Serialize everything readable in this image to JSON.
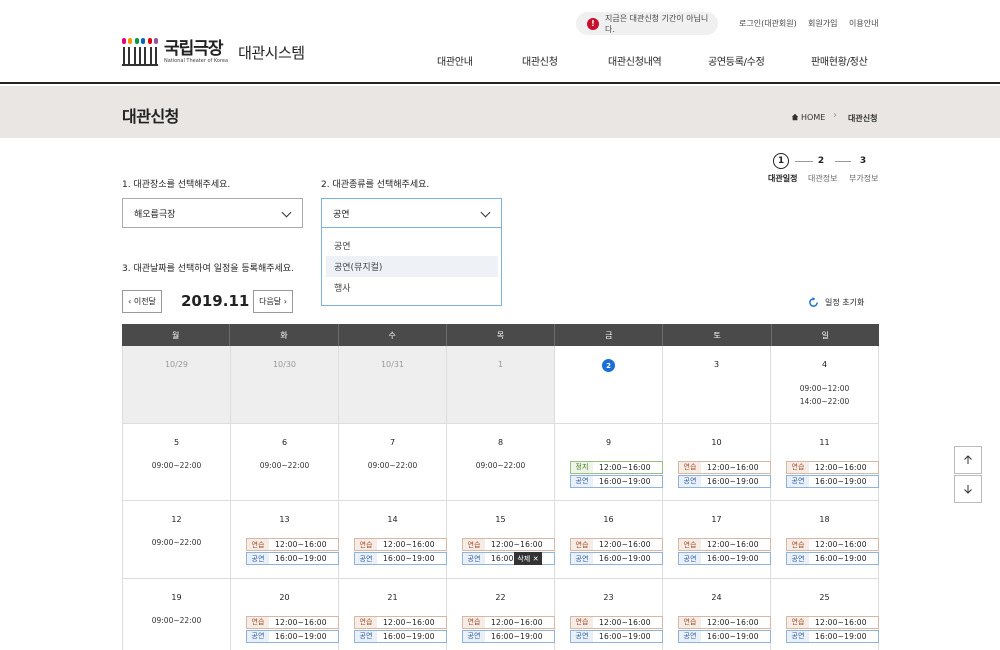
{
  "header": {
    "logo_name": "국립극장",
    "logo_sub": "National Theater of Korea",
    "system_name": "대관시스템",
    "notice": "지금은 대관신청 기간이 아닙니다.",
    "util": [
      "로그인(대관회원)",
      "회원가입",
      "이용안내"
    ],
    "gnb": [
      "대관안내",
      "대관신청",
      "대관신청내역",
      "공연등록/수정",
      "판매현황/정산"
    ]
  },
  "page": {
    "title": "대관신청",
    "breadcrumb_home": "HOME",
    "breadcrumb_current": "대관신청"
  },
  "steps": [
    {
      "num": "1",
      "label": "대관일정"
    },
    {
      "num": "2",
      "label": "대관정보"
    },
    {
      "num": "3",
      "label": "부가정보"
    }
  ],
  "form": {
    "q1": "1. 대관장소를 선택해주세요.",
    "q1_value": "해오름극장",
    "q2": "2. 대관종류를 선택해주세요.",
    "q2_value": "공연",
    "q2_options": [
      "공연",
      "공연(뮤지컬)",
      "행사"
    ],
    "q3": "3. 대관날짜를 선택하여 일정을 등록해주세요."
  },
  "calendar": {
    "prev_label": "이전달",
    "next_label": "다음달",
    "month": "2019.11",
    "reset_label": "일정 초기화",
    "weekdays": [
      "월",
      "화",
      "수",
      "목",
      "금",
      "토",
      "일"
    ],
    "tags": {
      "rehearsal": "연습",
      "show": "공연",
      "stop": "정지"
    },
    "delete_label": "삭제",
    "rows": [
      [
        {
          "date": "10/29"
        },
        {
          "date": "10/30"
        },
        {
          "date": "10/31"
        },
        {
          "date": "1"
        },
        {
          "date": "2"
        },
        {
          "date": "3"
        },
        {
          "date": "4",
          "times": [
            "09:00~12:00",
            "14:00~22:00"
          ]
        }
      ],
      [
        {
          "date": "5",
          "times": [
            "09:00~22:00"
          ]
        },
        {
          "date": "6",
          "times": [
            "09:00~22:00"
          ]
        },
        {
          "date": "7",
          "times": [
            "09:00~22:00"
          ]
        },
        {
          "date": "8",
          "times": [
            "09:00~22:00"
          ]
        },
        {
          "date": "9",
          "slot1": "12:00~16:00",
          "slot2": "16:00~19:00"
        },
        {
          "date": "10",
          "slot1": "12:00~16:00",
          "slot2": "16:00~19:00"
        },
        {
          "date": "11",
          "slot1": "12:00~16:00",
          "slot2": "16:00~19:00"
        }
      ],
      [
        {
          "date": "12",
          "times": [
            "09:00~22:00"
          ]
        },
        {
          "date": "13",
          "slot1": "12:00~16:00",
          "slot2": "16:00~19:00"
        },
        {
          "date": "14",
          "slot1": "12:00~16:00",
          "slot2": "16:00~19:00"
        },
        {
          "date": "15",
          "slot1": "12:00~16:00",
          "slot2": "16:00~"
        },
        {
          "date": "16",
          "slot1": "12:00~16:00",
          "slot2": "16:00~19:00"
        },
        {
          "date": "17",
          "slot1": "12:00~16:00",
          "slot2": "16:00~19:00"
        },
        {
          "date": "18",
          "slot1": "12:00~16:00",
          "slot2": "16:00~19:00"
        }
      ],
      [
        {
          "date": "19",
          "times": [
            "09:00~22:00"
          ]
        },
        {
          "date": "20",
          "slot1": "12:00~16:00",
          "slot2": "16:00~19:00"
        },
        {
          "date": "21",
          "slot1": "12:00~16:00",
          "slot2": "16:00~19:00"
        },
        {
          "date": "22",
          "slot1": "12:00~16:00",
          "slot2": "16:00~19:00"
        },
        {
          "date": "23",
          "slot1": "12:00~16:00",
          "slot2": "16:00~19:00"
        },
        {
          "date": "24",
          "slot1": "12:00~16:00",
          "slot2": "16:00~19:00"
        },
        {
          "date": "25",
          "slot1": "12:00~16:00",
          "slot2": "16:00~19:00"
        }
      ]
    ]
  },
  "colors": {
    "accent_blue": "#1a6fd8",
    "alert_red": "#c8102e",
    "header_bar": "#4a4a4a",
    "band": "#e9e6e3"
  },
  "icons": [
    "alert-icon",
    "home-icon",
    "chevron-down-icon",
    "refresh-icon",
    "arrow-up-icon",
    "arrow-down-icon",
    "close-icon"
  ]
}
